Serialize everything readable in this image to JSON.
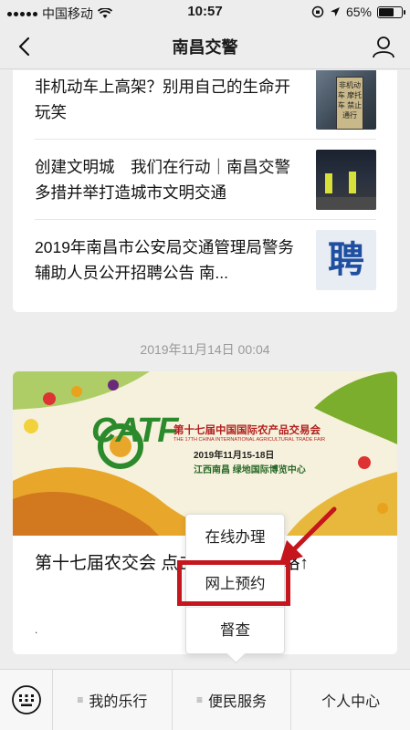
{
  "status_bar": {
    "carrier": "中国移动",
    "time": "10:57",
    "battery_percent": "65%",
    "battery_level": 0.65
  },
  "nav": {
    "title": "南昌交警"
  },
  "articles": [
    {
      "title": "非机动车上高架？别用自己的生命开玩笑",
      "thumb_text": "非机动车 摩托车 禁止通行"
    },
    {
      "title": "创建文明城　我们在行动｜南昌交警多措并举打造城市文明交通"
    },
    {
      "title": "2019年南昌市公安局交通管理局警务辅助人员公开招聘公告 南...",
      "thumb_text": "聘"
    }
  ],
  "timestamp": "2019年11月14日 00:04",
  "banner": {
    "logo": "CATF",
    "main_title": "第十七届中国国际农产品交易会",
    "sub_title": "THE 17TH CHINA INTERNATIONAL AGRICULTURAL TRADE FAIR",
    "date": "2019年11月15-18日",
    "venue": "江西南昌 绿地国际博览中心"
  },
  "bottom_article": {
    "title": "第十七届农交会             点击查看出行攻略↑",
    "dot": "."
  },
  "popup_menu": {
    "items": [
      "在线办理",
      "网上预约",
      "督查"
    ],
    "highlighted": "网上预约"
  },
  "menu_bar": {
    "items": [
      {
        "label": "我的乐行",
        "has_submenu": true
      },
      {
        "label": "便民服务",
        "has_submenu": true
      },
      {
        "label": "个人中心",
        "has_submenu": false
      }
    ]
  },
  "colors": {
    "highlight": "#c5161d",
    "background": "#ededed"
  }
}
